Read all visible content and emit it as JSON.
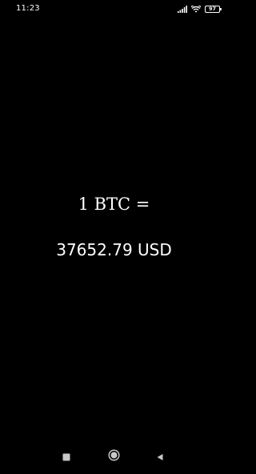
{
  "status_bar": {
    "time": "11:23",
    "battery_level": "97",
    "icons": [
      "cellular-signal-icon",
      "wifi-icon",
      "battery-icon"
    ]
  },
  "main": {
    "rate_label": "1 BTC =",
    "rate_value": "37652.79 USD"
  },
  "navigation": {
    "buttons": [
      "recents-button",
      "home-button",
      "back-button"
    ]
  },
  "colors": {
    "background": "#000000",
    "text": "#ffffff",
    "nav_icon": "#c8c8c8"
  }
}
